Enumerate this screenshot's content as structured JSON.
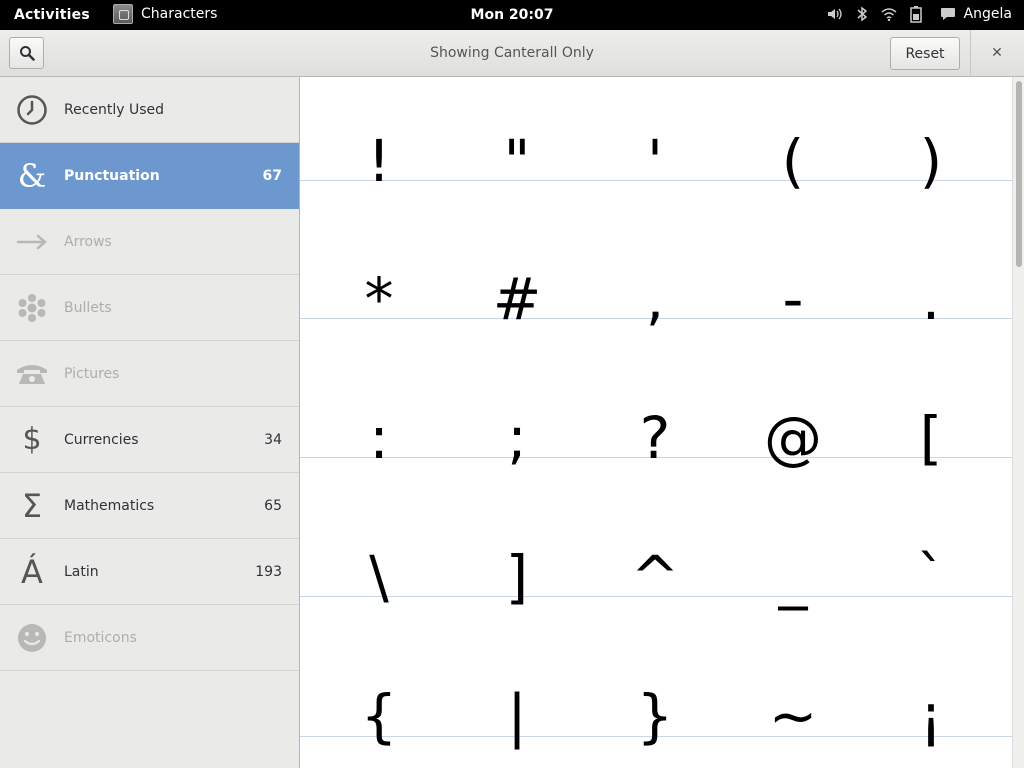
{
  "topbar": {
    "activities": "Activities",
    "app_name": "Characters",
    "clock": "Mon 20:07",
    "user": "Angela"
  },
  "header": {
    "title": "Showing Canterall Only",
    "reset_label": "Reset",
    "close_glyph": "✕"
  },
  "sidebar": {
    "items": [
      {
        "label": "Recently Used",
        "count": "",
        "icon": "clock-icon",
        "state": "normal"
      },
      {
        "label": "Punctuation",
        "count": "67",
        "icon": "ampersand-icon",
        "state": "active"
      },
      {
        "label": "Arrows",
        "count": "",
        "icon": "arrow-icon",
        "state": "disabled"
      },
      {
        "label": "Bullets",
        "count": "",
        "icon": "bullet-icon",
        "state": "disabled"
      },
      {
        "label": "Pictures",
        "count": "",
        "icon": "telephone-icon",
        "state": "disabled"
      },
      {
        "label": "Currencies",
        "count": "34",
        "icon": "dollar-icon",
        "state": "normal"
      },
      {
        "label": "Mathematics",
        "count": "65",
        "icon": "sigma-icon",
        "state": "normal"
      },
      {
        "label": "Latin",
        "count": "193",
        "icon": "latin-a-icon",
        "state": "normal"
      },
      {
        "label": "Emoticons",
        "count": "",
        "icon": "smiley-icon",
        "state": "disabled"
      }
    ]
  },
  "grid": {
    "characters": [
      "!",
      "\"",
      "'",
      "(",
      ")",
      "*",
      "#",
      ",",
      "-",
      ".",
      ":",
      ";",
      "?",
      "@",
      "[",
      "\\",
      "]",
      "^",
      "_",
      "`",
      "{",
      "|",
      "}",
      "~",
      "¡"
    ]
  },
  "colors": {
    "accent": "#6c98cf",
    "sidebar_bg": "#eaeae8",
    "grid_line": "#c9d6e8"
  }
}
